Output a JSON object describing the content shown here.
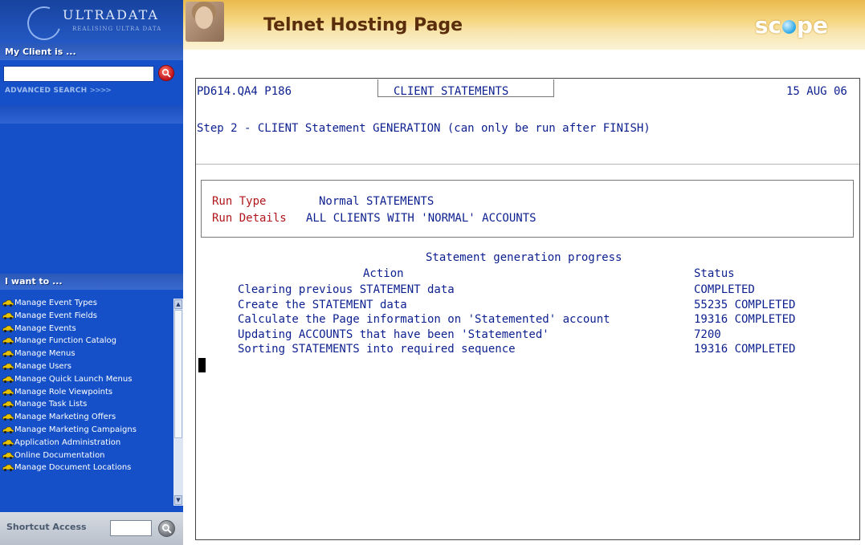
{
  "sidebar": {
    "logo_text": "ULTRADATA",
    "logo_tagline": "REALISING ULTRA DATA",
    "client_header": "My Client is ...",
    "search_placeholder": "",
    "advanced_search_label": "ADVANCED SEARCH",
    "advanced_search_arrows": ">>>>",
    "iwant_header": "I want to ...",
    "menu_items": [
      "Manage Event Types",
      "Manage Event Fields",
      "Manage Events",
      "Manage Function Catalog",
      "Manage Menus",
      "Manage Users",
      "Manage Quick Launch Menus",
      "Manage Role Viewpoints",
      "Manage Task Lists",
      "Manage Marketing Offers",
      "Manage Marketing Campaigns",
      "Application Administration",
      "Online Documentation",
      "Manage Document Locations"
    ],
    "shortcut_label": "Shortcut Access"
  },
  "banner": {
    "title": "Telnet Hosting Page",
    "brand_pre": "sc",
    "brand_post": "pe"
  },
  "terminal": {
    "screen_id": "PD614.QA4 P186",
    "screen_title": "CLIENT STATEMENTS",
    "date": "15 AUG 06",
    "step": "Step 2 - CLIENT Statement GENERATION (can only be run after FINISH)",
    "run_type_label": "Run Type",
    "run_type_value": "Normal STATEMENTS",
    "run_details_label": "Run Details",
    "run_details_value": "ALL CLIENTS WITH 'NORMAL' ACCOUNTS",
    "progress_title": "Statement generation progress",
    "action_header": "Action",
    "status_header": "Status",
    "rows": [
      {
        "action": "Clearing previous STATEMENT data",
        "status": "COMPLETED"
      },
      {
        "action": "Create the STATEMENT data",
        "status": "55235 COMPLETED"
      },
      {
        "action": "Calculate the Page information on 'Statemented' account",
        "status": "19316 COMPLETED"
      },
      {
        "action": "Updating ACCOUNTS that have been 'Statemented'",
        "status": "7200"
      },
      {
        "action": "Sorting STATEMENTS into required sequence",
        "status": "19316 COMPLETED"
      }
    ]
  },
  "colors": {
    "sidebar_bg": "#1550c8",
    "terminal_text": "#0c1f8f",
    "terminal_label": "#b0171c",
    "banner_title": "#5a2d0c"
  }
}
